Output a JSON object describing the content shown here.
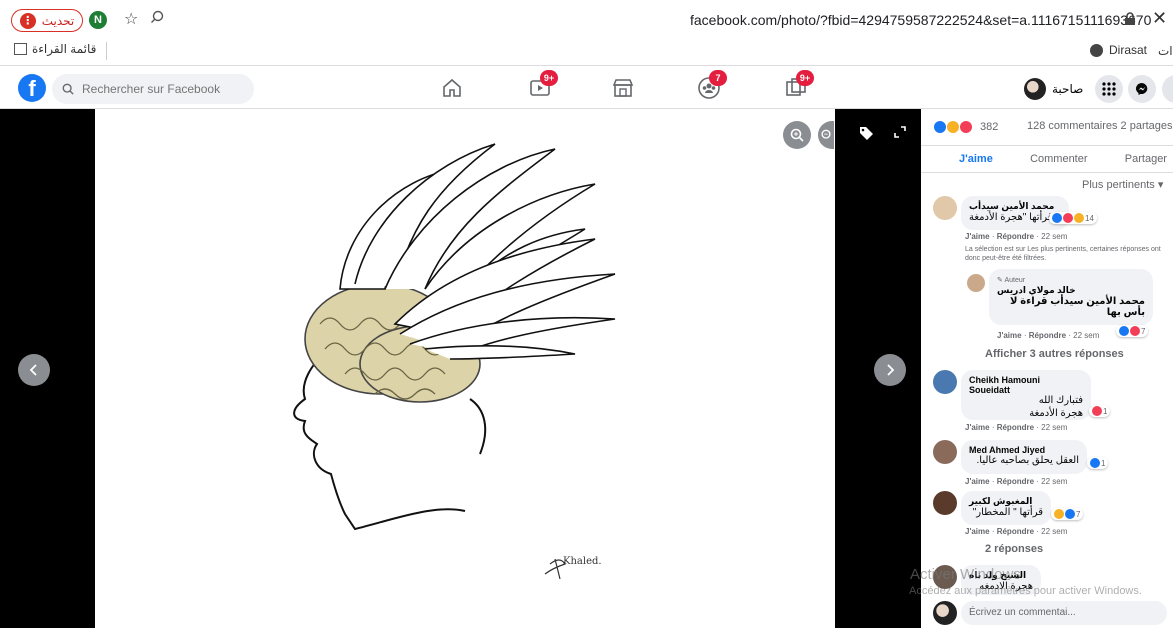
{
  "browser": {
    "update_label": "تحديث",
    "profile_initial": "N",
    "url": "facebook.com/photo/?fbid=4294759587222524&set=a.1116715111693670",
    "bookmarks": {
      "reading_list": "قائمة القراءة",
      "dirasat": "Dirasat",
      "right_fragment": "ات"
    }
  },
  "header": {
    "search_placeholder": "Rechercher sur Facebook",
    "watch_badge": "9+",
    "groups_badge": "7",
    "gaming_badge": "9+",
    "profile_name": "صاحبة",
    "logo_letter": "f"
  },
  "photo": {
    "signature": "Khaled."
  },
  "panel": {
    "reaction_count": "382",
    "stats": "128 commentaires 2 partages",
    "actions": {
      "like": "J'aime",
      "comment": "Commenter",
      "share": "Partager"
    },
    "sort_label": "Plus pertinents ▾",
    "comments": [
      {
        "name": "محمد الأمين سيدأب",
        "text": "قرأتها \"هجرة الأدمغة \"",
        "reactions": "14",
        "meta_like": "J'aime",
        "meta_reply": "Répondre",
        "meta_time": "· 22 sem",
        "filter_note": "La sélection est sur Les plus pertinents, certaines réponses ont donc peut-être été filtrées."
      },
      {
        "author_tag": "Auteur",
        "name": "خالد مولاي ادريس",
        "text": "محمد الأمين سيدأب قراءة لا بأس بها",
        "reactions": "7",
        "meta_like": "J'aime",
        "meta_reply": "Répondre",
        "meta_time": "· 22 sem"
      },
      {
        "name": "Cheikh Hamouni Soueidatt",
        "text": "فتبارك الله",
        "text2": "هجرة الأدمغة",
        "reactions": "1",
        "meta_like": "J'aime",
        "meta_reply": "Répondre",
        "meta_time": "· 22 sem"
      },
      {
        "name": "Med Ahmed Jiyed",
        "text": "العقل يحلق بصاحبه عاليا.",
        "reactions": "1",
        "meta_like": "J'aime",
        "meta_reply": "Répondre",
        "meta_time": "· 22 sem"
      },
      {
        "name": "المغبوش لكبير",
        "text": "قرأتها \" المخطار\"",
        "reactions": "7",
        "meta_like": "J'aime",
        "meta_reply": "Répondre",
        "meta_time": "· 22 sem"
      },
      {
        "name": "الشيخ ولد ناه",
        "text": "هجرة الادمغه"
      }
    ],
    "show_more_replies": "Afficher 3 autres réponses",
    "two_replies": "2 réponses",
    "comment_placeholder": "Écrivez un commentai..."
  },
  "watermark": {
    "line1": "Activer Windows",
    "line2": "Accédez aux paramètres pour activer Windows."
  }
}
